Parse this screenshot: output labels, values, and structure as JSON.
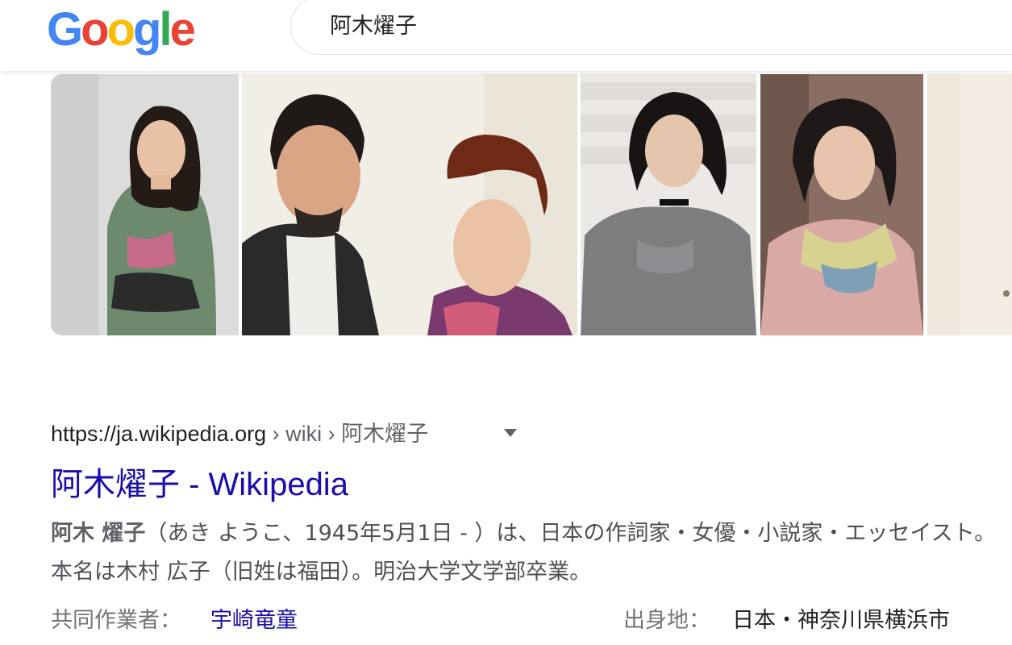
{
  "logo": {
    "letters": [
      "G",
      "o",
      "o",
      "g",
      "l",
      "e"
    ],
    "colors": [
      "#4285F4",
      "#EA4335",
      "#FBBC05",
      "#4285F4",
      "#34A853",
      "#EA4335"
    ]
  },
  "search": {
    "query": "阿木燿子"
  },
  "images": [
    {
      "icon": "portrait-photo"
    },
    {
      "icon": "portrait-photo"
    },
    {
      "icon": "portrait-photo"
    },
    {
      "icon": "portrait-photo"
    },
    {
      "icon": "portrait-photo"
    }
  ],
  "result": {
    "url_domain": "https://ja.wikipedia.org",
    "url_path": " › wiki › 阿木燿子",
    "title": "阿木燿子 - Wikipedia",
    "snippet_bold": "阿木 燿子",
    "snippet_rest": "（あき ようこ、1945年5月1日 - ）は、日本の作詞家・女優・小説家・エッセイスト。",
    "snippet_line2": "本名は木村 広子（旧姓は福田）。明治大学文学部卒業。",
    "fact1_label": "共同作業者：",
    "fact1_value": "宇崎竜童",
    "fact2_label": "出身地：",
    "fact2_value": "日本・神奈川県横浜市"
  }
}
